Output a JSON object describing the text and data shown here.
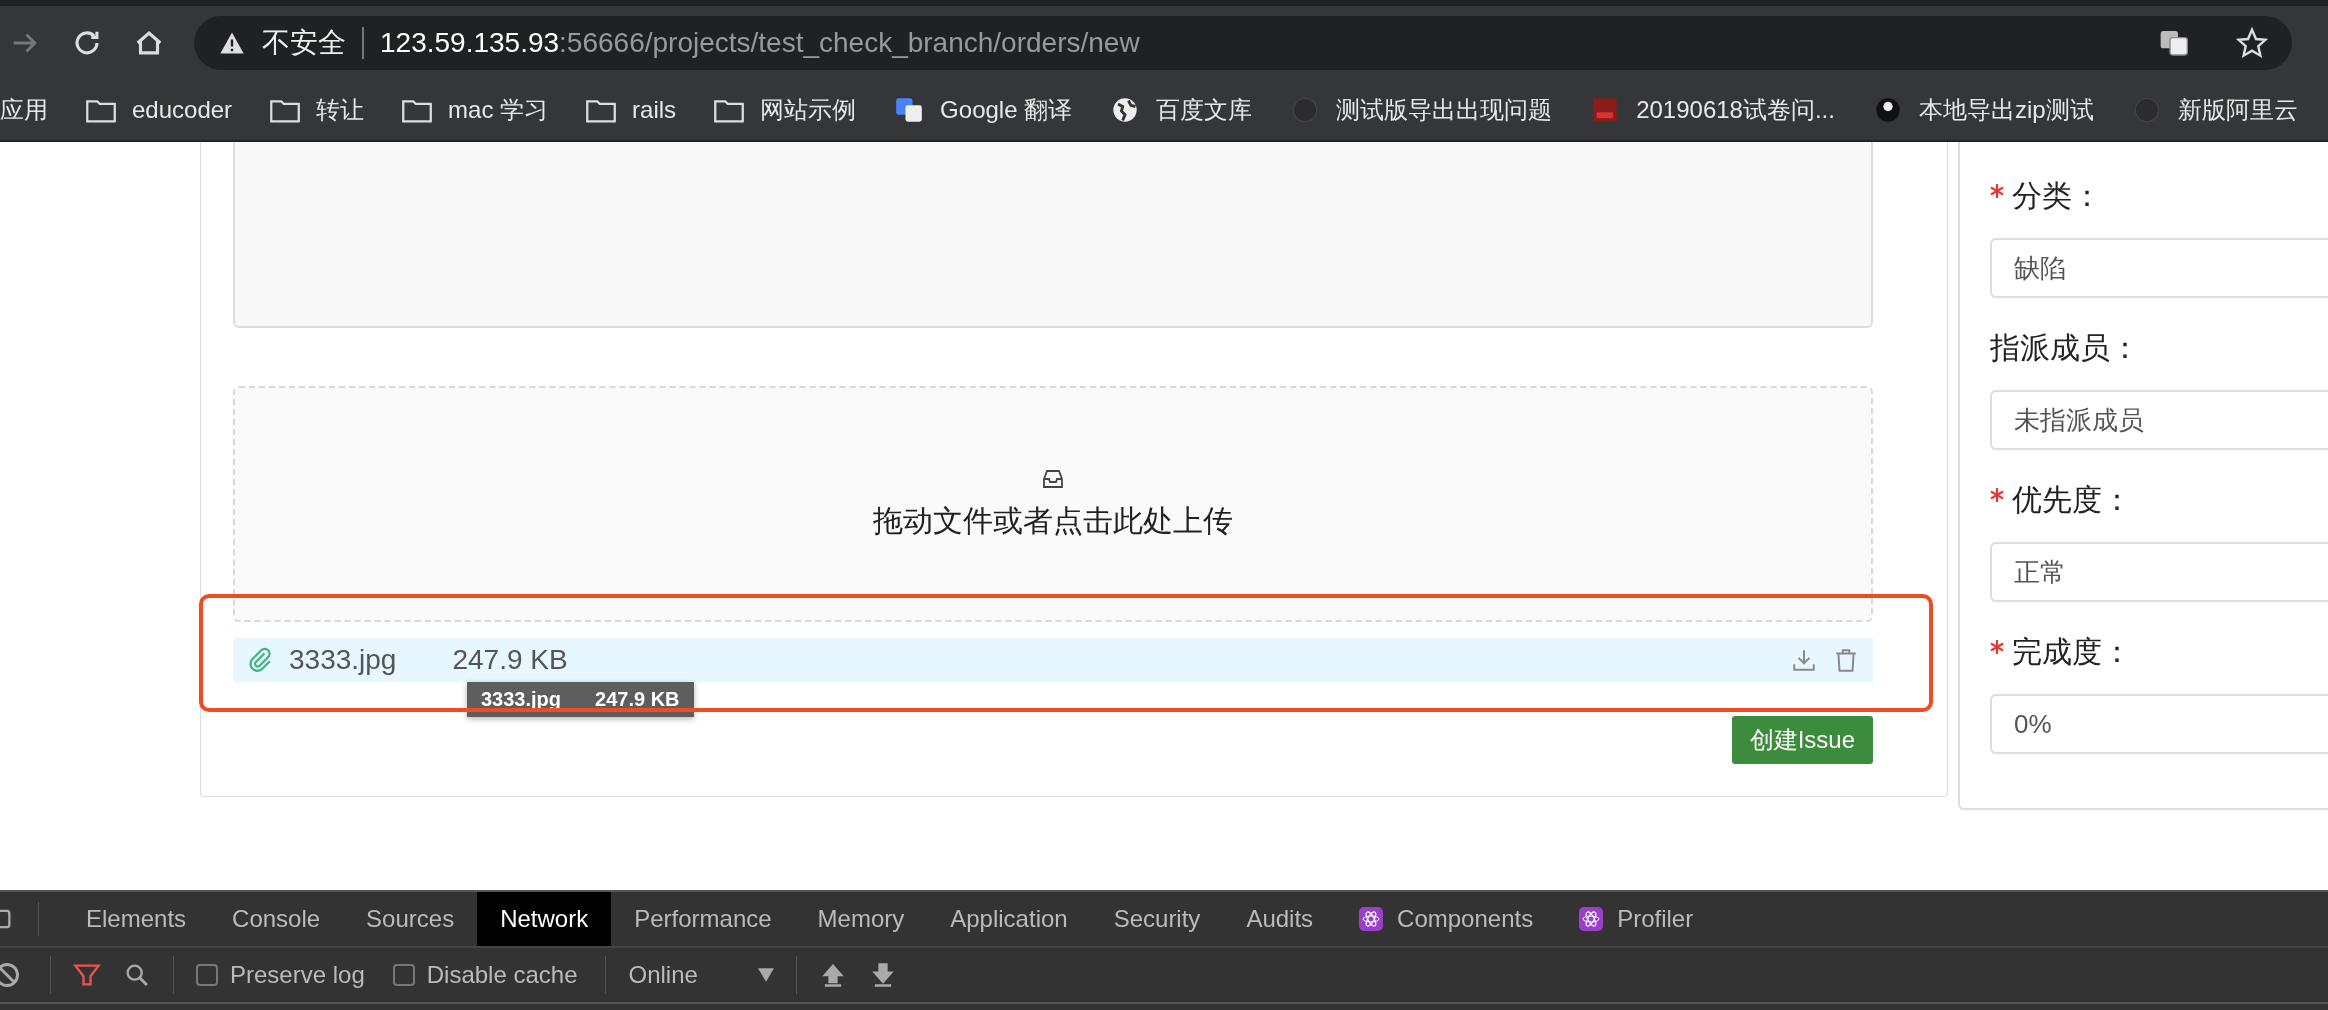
{
  "browser": {
    "address": {
      "security_label": "不安全",
      "host": "123.59.135.93",
      "path": ":56666/projects/test_check_branch/orders/new"
    },
    "bookmarks": [
      {
        "kind": "text",
        "label": "应用"
      },
      {
        "kind": "folder",
        "label": "educoder"
      },
      {
        "kind": "folder",
        "label": "转让"
      },
      {
        "kind": "folder",
        "label": "mac 学习"
      },
      {
        "kind": "folder",
        "label": "rails"
      },
      {
        "kind": "folder",
        "label": "网站示例"
      },
      {
        "kind": "translate",
        "label": "Google 翻译"
      },
      {
        "kind": "globe",
        "label": "百度文库"
      },
      {
        "kind": "octocat",
        "label": "测试版导出出现问题"
      },
      {
        "kind": "image",
        "label": "20190618试卷问..."
      },
      {
        "kind": "avatar",
        "label": "本地导出zip测试"
      },
      {
        "kind": "octocat",
        "label": "新版阿里云"
      }
    ]
  },
  "upload": {
    "hint": "拖动文件或者点击此处上传",
    "file": {
      "name": "3333.jpg",
      "size": "247.9 KB"
    },
    "tooltip": {
      "name": "3333.jpg",
      "size": "247.9 KB"
    }
  },
  "submit_button": "创建Issue",
  "form_fields": [
    {
      "label": "分类：",
      "required": true,
      "value": "缺陷"
    },
    {
      "label": "指派成员：",
      "required": false,
      "value": "未指派成员"
    },
    {
      "label": "优先度：",
      "required": true,
      "value": "正常"
    },
    {
      "label": "完成度：",
      "required": true,
      "value": "0%"
    }
  ],
  "devtools": {
    "tabs": [
      {
        "label": "Elements",
        "selected": false,
        "icon": false
      },
      {
        "label": "Console",
        "selected": false,
        "icon": false
      },
      {
        "label": "Sources",
        "selected": false,
        "icon": false
      },
      {
        "label": "Network",
        "selected": true,
        "icon": false
      },
      {
        "label": "Performance",
        "selected": false,
        "icon": false
      },
      {
        "label": "Memory",
        "selected": false,
        "icon": false
      },
      {
        "label": "Application",
        "selected": false,
        "icon": false
      },
      {
        "label": "Security",
        "selected": false,
        "icon": false
      },
      {
        "label": "Audits",
        "selected": false,
        "icon": false
      },
      {
        "label": "Components",
        "selected": false,
        "icon": true
      },
      {
        "label": "Profiler",
        "selected": false,
        "icon": true
      }
    ],
    "checkboxes": [
      {
        "label": "Preserve log",
        "checked": false
      },
      {
        "label": "Disable cache",
        "checked": false
      }
    ],
    "throttling": "Online"
  }
}
